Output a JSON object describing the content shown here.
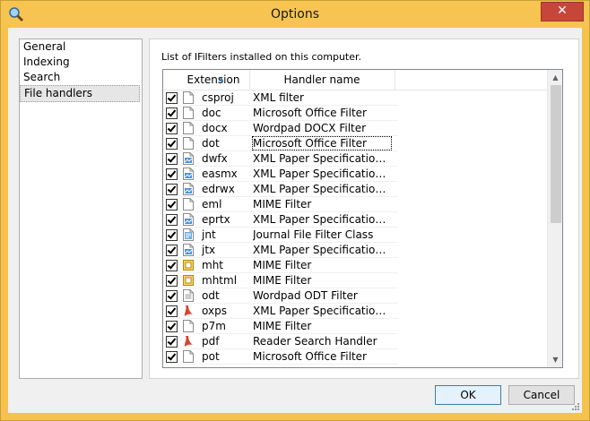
{
  "window": {
    "title": "Options",
    "close_glyph": "✕"
  },
  "nav": {
    "items": [
      "General",
      "Indexing",
      "Search",
      "File handlers"
    ],
    "selected": 3
  },
  "panel": {
    "label": "List of IFilters installed on this computer."
  },
  "table": {
    "columns": [
      "Extension",
      "Handler name"
    ],
    "rows": [
      {
        "ext": "csproj",
        "handler": "XML filter",
        "icon": "blank-file-icon"
      },
      {
        "ext": "doc",
        "handler": "Microsoft Office Filter",
        "icon": "blank-file-icon"
      },
      {
        "ext": "docx",
        "handler": "Wordpad DOCX Filter",
        "icon": "blank-file-icon"
      },
      {
        "ext": "dot",
        "handler": "Microsoft Office Filter",
        "icon": "blank-file-icon"
      },
      {
        "ext": "dwfx",
        "handler": "XML Paper Specification Filter",
        "icon": "xps-file-icon"
      },
      {
        "ext": "easmx",
        "handler": "XML Paper Specification Filter",
        "icon": "xps-file-icon"
      },
      {
        "ext": "edrwx",
        "handler": "XML Paper Specification Filter",
        "icon": "xps-file-icon"
      },
      {
        "ext": "eml",
        "handler": "MIME Filter",
        "icon": "blank-file-icon"
      },
      {
        "ext": "eprtx",
        "handler": "XML Paper Specification Filter",
        "icon": "xps-file-icon"
      },
      {
        "ext": "jnt",
        "handler": "Journal File Filter Class",
        "icon": "journal-file-icon"
      },
      {
        "ext": "jtx",
        "handler": "XML Paper Specification Filter",
        "icon": "xps-file-icon"
      },
      {
        "ext": "mht",
        "handler": "MIME Filter",
        "icon": "mht-file-icon"
      },
      {
        "ext": "mhtml",
        "handler": "MIME Filter",
        "icon": "mht-file-icon"
      },
      {
        "ext": "odt",
        "handler": "Wordpad ODT Filter",
        "icon": "text-file-icon"
      },
      {
        "ext": "oxps",
        "handler": "XML Paper Specification Filter",
        "icon": "pdf-file-icon"
      },
      {
        "ext": "p7m",
        "handler": "MIME Filter",
        "icon": "blank-file-icon"
      },
      {
        "ext": "pdf",
        "handler": "Reader Search Handler",
        "icon": "pdf-file-icon"
      },
      {
        "ext": "pot",
        "handler": "Microsoft Office Filter",
        "icon": "blank-file-icon"
      }
    ],
    "focused_row": 3
  },
  "buttons": {
    "ok": "OK",
    "cancel": "Cancel"
  },
  "colors": {
    "titlebar": "#f7c451",
    "close": "#c7463a",
    "accent": "#3c7fb1"
  }
}
